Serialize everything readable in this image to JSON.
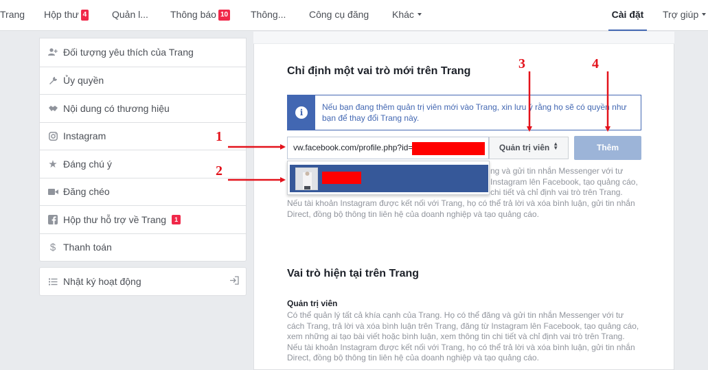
{
  "nav": {
    "items": [
      {
        "label": "Trang"
      },
      {
        "label": "Hộp thư",
        "badge": "4"
      },
      {
        "label": "Quản l..."
      },
      {
        "label": "Thông báo",
        "badge": "10"
      },
      {
        "label": "Thông..."
      },
      {
        "label": "Công cụ đăng"
      },
      {
        "label": "Khác"
      },
      {
        "label": "Cài đặt"
      },
      {
        "label": "Trợ giúp"
      }
    ]
  },
  "sidebar": {
    "items": [
      {
        "label": "Đối tượng yêu thích của Trang",
        "icon": "add-person-icon"
      },
      {
        "label": "Ủy quyền",
        "icon": "wrench-icon"
      },
      {
        "label": "Nội dung có thương hiệu",
        "icon": "handshake-icon"
      },
      {
        "label": "Instagram",
        "icon": "instagram-icon"
      },
      {
        "label": "Đáng chú ý",
        "icon": "star-icon"
      },
      {
        "label": "Đăng chéo",
        "icon": "video-camera-icon"
      },
      {
        "label": "Hộp thư hỗ trợ về Trang",
        "icon": "facebook-icon",
        "badge": "1"
      },
      {
        "label": "Thanh toán",
        "icon": "dollar-icon"
      }
    ],
    "activity_log": "Nhật ký hoạt động"
  },
  "assign": {
    "title": "Chỉ định một vai trò mới trên Trang",
    "info_text": "Nếu bạn đang thêm quản trị viên mới vào Trang, xin lưu ý rằng họ sẽ có quyền như bạn để thay đổi Trang này.",
    "input_value": "vw.facebook.com/profile.php?id=",
    "role_select": "Quản trị viên",
    "add_button": "Thêm",
    "desc_right_lines": [
      "ng và gửi tin nhắn Messenger với tư",
      "Instagram lên Facebook, tạo quảng cáo,",
      "chi tiết và chỉ định vai trò trên Trang."
    ],
    "desc_full_lines": [
      "Nếu tài khoản Instagram được kết nối với Trang, họ có thể trả lời và xóa bình luận, gửi tin nhắn",
      "Direct, đồng bộ thông tin liên hệ của doanh nghiệp và tạo quảng cáo."
    ]
  },
  "current_roles": {
    "title": "Vai trò hiện tại trên Trang",
    "role_name": "Quản trị viên",
    "desc_lines": [
      "Có thể quản lý tất cả khía cạnh của Trang. Họ có thể đăng và gửi tin nhắn Messenger với tư",
      "cách Trang, trả lời và xóa bình luận trên Trang, đăng từ Instagram lên Facebook, tạo quảng cáo,",
      "xem những ai tạo bài viết hoặc bình luận, xem thông tin chi tiết và chỉ định vai trò trên Trang.",
      "Nếu tài khoản Instagram được kết nối với Trang, họ có thể trả lời và xóa bình luận, gửi tin nhắn",
      "Direct, đồng bộ thông tin liên hệ của doanh nghiệp và tạo quảng cáo."
    ]
  },
  "annotations": {
    "step1": "1",
    "step2": "2",
    "step3": "3",
    "step4": "4"
  },
  "colors": {
    "brand": "#4267b2",
    "badge": "#f02849",
    "annotation": "#e3121b",
    "disabled_button": "#9cb4d8"
  }
}
